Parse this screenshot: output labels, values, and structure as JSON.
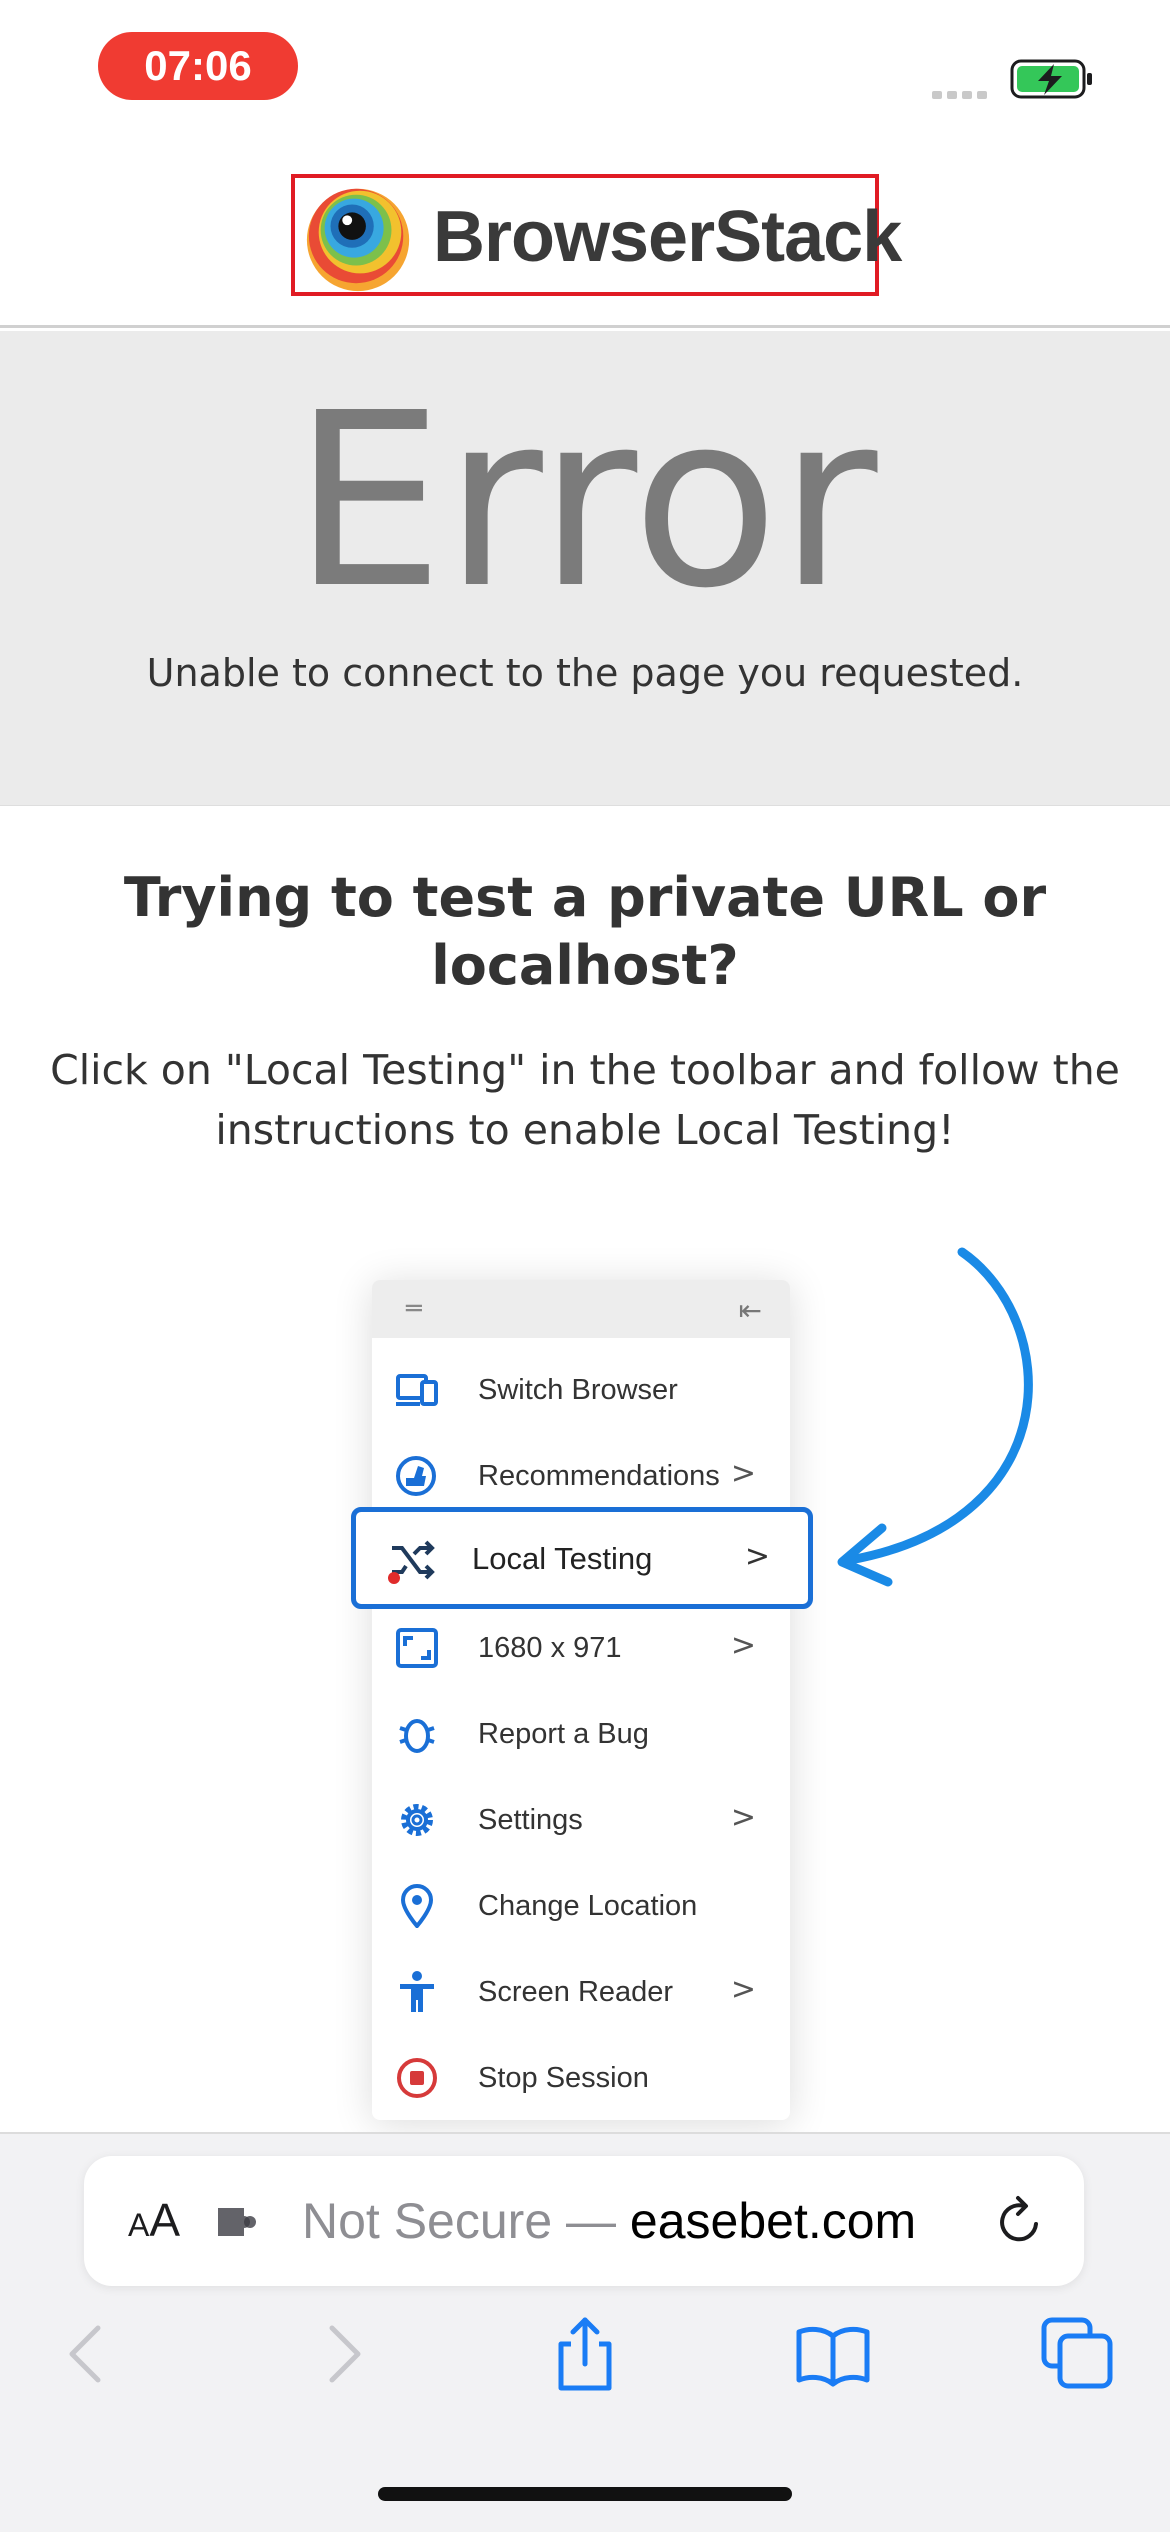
{
  "status_bar": {
    "time": "07:06",
    "time_pill_color": "#f03b32",
    "battery_state": "charging",
    "battery_icon": "battery-charging-icon",
    "signal_icon": "signal-dots-icon"
  },
  "logo": {
    "brand_text": "BrowserStack",
    "icon": "browserstack-eye-logo"
  },
  "error": {
    "title": "Error",
    "message": "Unable to connect to the page you requested."
  },
  "help": {
    "heading": "Trying to test a private URL or localhost?",
    "body": "Click on \"Local Testing\" in the toolbar and follow the instructions to enable Local Testing!"
  },
  "illustration": {
    "menu_items": [
      {
        "label": "Switch Browser",
        "icon": "switch-browser-icon",
        "chevron": ""
      },
      {
        "label": "Recommendations",
        "icon": "recommendations-icon",
        "chevron": ">"
      },
      {
        "label": "Local Testing",
        "icon": "local-testing-icon",
        "chevron": ">"
      },
      {
        "label": "1680 x 971",
        "icon": "resolution-icon",
        "chevron": ">"
      },
      {
        "label": "Report a Bug",
        "icon": "bug-icon",
        "chevron": ""
      },
      {
        "label": "Settings",
        "icon": "settings-icon",
        "chevron": ">"
      },
      {
        "label": "Change Location",
        "icon": "location-pin-icon",
        "chevron": ""
      },
      {
        "label": "Screen Reader",
        "icon": "accessibility-icon",
        "chevron": ">"
      },
      {
        "label": "Stop Session",
        "icon": "stop-icon",
        "chevron": ""
      }
    ],
    "accent_color": "#1a6fd6",
    "arrow_color": "#1a8ae6"
  },
  "browser": {
    "text_size_label_small": "A",
    "text_size_label_big": "A",
    "not_secure": "Not Secure — ",
    "domain": "easebet.com",
    "nav": {
      "back_icon": "chevron-left-icon",
      "forward_icon": "chevron-right-icon",
      "share_icon": "share-icon",
      "bookmarks_icon": "book-icon",
      "tabs_icon": "tabs-icon"
    }
  }
}
